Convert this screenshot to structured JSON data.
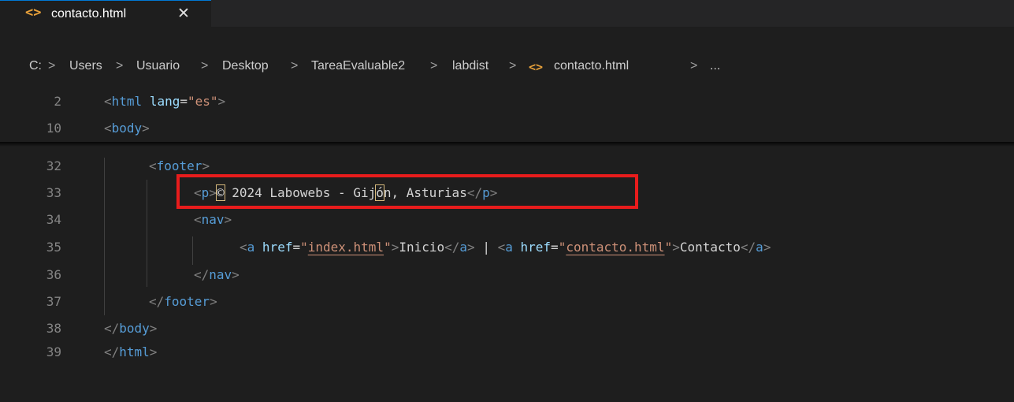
{
  "tab": {
    "icon": "<>",
    "icon_name": "html-file-icon",
    "label": "contacto.html",
    "close": "✕"
  },
  "breadcrumb": {
    "items": [
      "C:",
      "Users",
      "Usuario",
      "Desktop",
      "TareaEvaluable2",
      "labdist",
      "contacto.html",
      "..."
    ],
    "separator": ">"
  },
  "sticky": [
    {
      "num": "2",
      "code": "<html lang=\"es\">"
    },
    {
      "num": "10",
      "code": "<body>"
    }
  ],
  "lines": [
    {
      "num": "32",
      "code": "<footer>"
    },
    {
      "num": "33",
      "code": "<p>© 2024 Labowebs - Gijón, Asturias</p>"
    },
    {
      "num": "34",
      "code": "<nav>"
    },
    {
      "num": "35",
      "code": "<a href=\"index.html\">Inicio</a> | <a href=\"contacto.html\">Contacto</a>"
    },
    {
      "num": "36",
      "code": "</nav>"
    },
    {
      "num": "37",
      "code": "</footer>"
    },
    {
      "num": "38",
      "code": "</body>"
    },
    {
      "num": "39",
      "code": "</html>"
    }
  ],
  "colors": {
    "background": "#1e1e1e",
    "tag": "#569cd6",
    "attribute": "#9cdcfe",
    "string": "#ce9178",
    "text": "#d4d4d4",
    "highlight_box": "#e81c1c"
  }
}
